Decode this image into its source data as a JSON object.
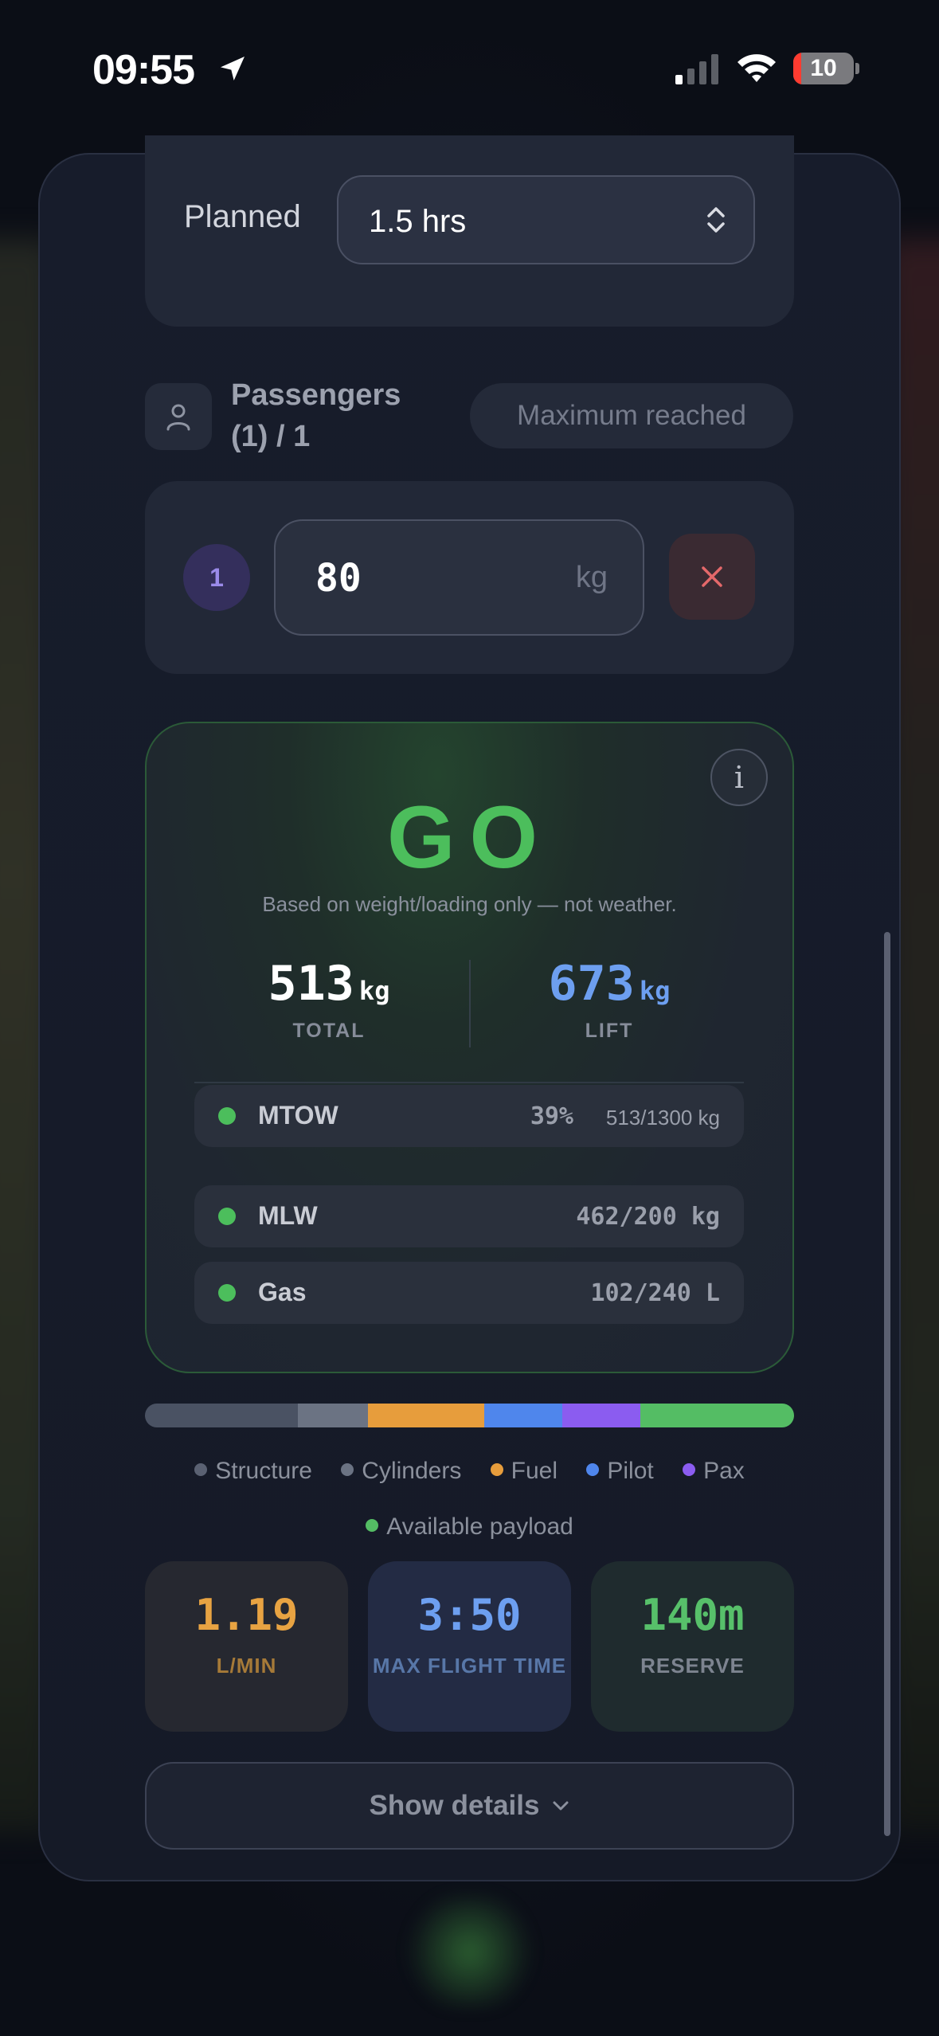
{
  "status_bar": {
    "time": "09:55",
    "battery": "10"
  },
  "planned": {
    "label": "Planned",
    "value": "1.5 hrs"
  },
  "passengers": {
    "title": "Passengers (1) / 1",
    "badge": "Maximum reached",
    "items": [
      {
        "index": "1",
        "weight": "80",
        "unit": "kg"
      }
    ]
  },
  "go_card": {
    "verdict": "GO",
    "subtitle": "Based on weight/loading only — not weather.",
    "info": "i",
    "total": {
      "value": "513",
      "unit": "kg",
      "label": "TOTAL"
    },
    "lift": {
      "value": "673",
      "unit": "kg",
      "label": "LIFT"
    },
    "checks": [
      {
        "name": "MTOW",
        "pct": "39%",
        "value": "513/1300 kg",
        "percent": 39
      },
      {
        "name": "MLW",
        "pct": "",
        "value": "462/200 kg"
      },
      {
        "name": "Gas",
        "pct": "",
        "value": "102/240 L"
      }
    ]
  },
  "breakdown": {
    "segments": [
      {
        "name": "Structure",
        "share": 0.236,
        "color": "#4a5263"
      },
      {
        "name": "Cylinders",
        "share": 0.107,
        "color": "#6b7383"
      },
      {
        "name": "Fuel",
        "share": 0.18,
        "color": "#e79d3c"
      },
      {
        "name": "Pilot",
        "share": 0.12,
        "color": "#4f86ec"
      },
      {
        "name": "Pax",
        "share": 0.12,
        "color": "#8b5cf0"
      },
      {
        "name": "Available payload",
        "share": 0.237,
        "color": "#54bd64"
      }
    ],
    "legend": [
      "Structure",
      "Cylinders",
      "Fuel",
      "Pilot",
      "Pax",
      "Available payload"
    ]
  },
  "tiles": [
    {
      "value": "1.19",
      "label": "L/MIN",
      "color": "#e8a342",
      "label_color": "#a67a38",
      "bg": "#262830"
    },
    {
      "value": "3:50",
      "label": "MAX FLIGHT TIME",
      "color": "#6d9ff0",
      "label_color": "#5877a8",
      "bg": "#232b44"
    },
    {
      "value": "140m",
      "label": "RESERVE",
      "color": "#57c06a",
      "label_color": "#7d8490",
      "bg": "#1f2b2e"
    }
  ],
  "details_button": "Show details",
  "colors": {
    "go_green": "#4cbe5c",
    "lift_blue": "#6d9ff0",
    "total_white": "#ffffff"
  }
}
